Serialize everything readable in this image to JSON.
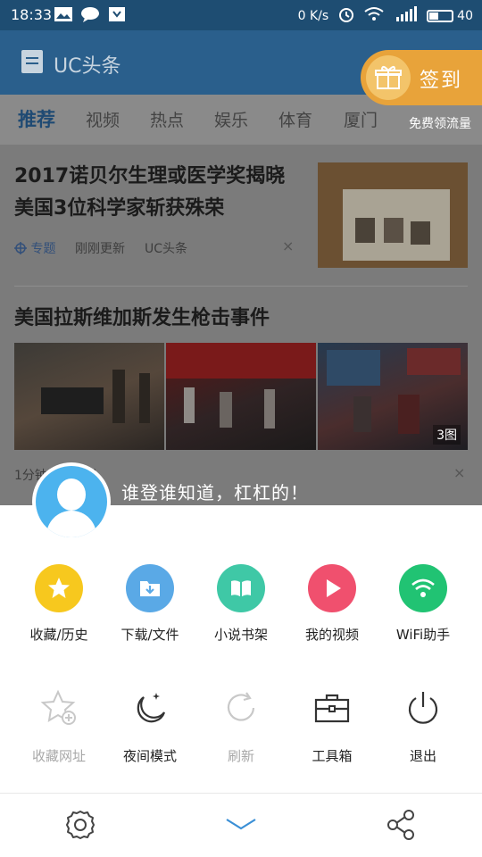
{
  "status_bar": {
    "time": "18:33",
    "network_speed": "0 K/s",
    "battery_level": "40",
    "icons": [
      "image-icon",
      "chat-bubble-icon",
      "download-icon",
      "alarm-icon",
      "wifi-icon",
      "signal-4g-icon",
      "battery-icon"
    ]
  },
  "app_bar": {
    "title": "UC头条",
    "checkin_label": "签到",
    "free_data_label": "免费领流量"
  },
  "tabs": [
    {
      "label": "推荐",
      "active": true
    },
    {
      "label": "视频",
      "active": false
    },
    {
      "label": "热点",
      "active": false
    },
    {
      "label": "娱乐",
      "active": false
    },
    {
      "label": "体育",
      "active": false
    },
    {
      "label": "厦门",
      "active": false
    }
  ],
  "feed": {
    "article1": {
      "title": "2017诺贝尔生理或医学奖揭晓 美国3位科学家斩获殊荣",
      "tag": "专题",
      "time": "刚刚更新",
      "source": "UC头条",
      "close": "×"
    },
    "article2": {
      "title": "美国拉斯维加斯发生枪击事件",
      "photo_count": "3图",
      "meta": "1分钟前  ·  新网",
      "close": "×"
    }
  },
  "user": {
    "login_prompt": "谁登谁知道，杠杠的！"
  },
  "menu_row1": [
    {
      "label": "收藏/历史",
      "icon": "star-icon",
      "color": "#f7c81e"
    },
    {
      "label": "下载/文件",
      "icon": "download-folder-icon",
      "color": "#5aa9e6"
    },
    {
      "label": "小说书架",
      "icon": "book-icon",
      "color": "#3fc8a6"
    },
    {
      "label": "我的视频",
      "icon": "play-icon",
      "color": "#f0506e"
    },
    {
      "label": "WiFi助手",
      "icon": "wifi-icon",
      "color": "#21c373"
    }
  ],
  "menu_row2": [
    {
      "label": "收藏网址",
      "icon": "star-add-icon",
      "enabled": false
    },
    {
      "label": "夜间模式",
      "icon": "moon-icon",
      "enabled": true
    },
    {
      "label": "刷新",
      "icon": "refresh-icon",
      "enabled": false
    },
    {
      "label": "工具箱",
      "icon": "toolbox-icon",
      "enabled": true
    },
    {
      "label": "退出",
      "icon": "power-icon",
      "enabled": true
    }
  ],
  "bottom_bar": {
    "icons": [
      "settings-gear-icon",
      "collapse-chevron-icon",
      "share-icon"
    ]
  }
}
